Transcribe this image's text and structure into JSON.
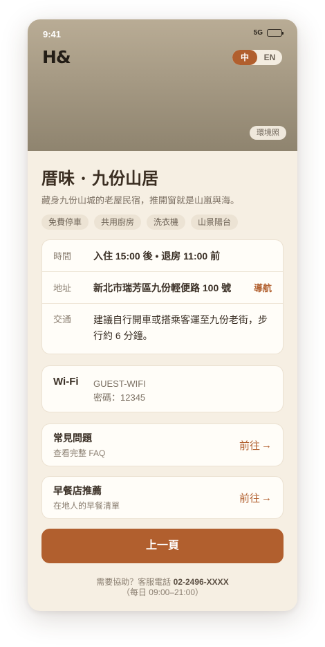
{
  "status": {
    "time": "9:41",
    "network": "5G"
  },
  "header": {
    "logo": "H&",
    "lang_zh": "中",
    "lang_en": "EN",
    "env_photo": "環境照"
  },
  "property": {
    "title": "厝味 · 九份山居",
    "subtitle": "藏身九份山城的老屋民宿，推開窗就是山嵐與海。",
    "tags": [
      "免費停車",
      "共用廚房",
      "洗衣機",
      "山景陽台"
    ]
  },
  "info": {
    "time_label": "時間",
    "time_value": "入住 15:00 後 • 退房 11:00 前",
    "address_label": "地址",
    "address_value": "新北市瑞芳區九份輕便路 100 號",
    "navigate_label": "導航",
    "transport_label": "交通",
    "transport_value": "建議自行開車或搭乘客運至九份老街，步行約 6 分鐘。"
  },
  "wifi": {
    "label": "Wi-Fi",
    "ssid": "GUEST-WIFI",
    "password": "密碼：12345"
  },
  "faq": {
    "title": "常見問題",
    "subtitle": "查看完整 FAQ",
    "go": "前往"
  },
  "breakfast": {
    "title": "早餐店推薦",
    "subtitle": "在地人的早餐清單",
    "go": "前往"
  },
  "back_button": "上一頁",
  "help": {
    "prefix": "需要協助？客服電話 ",
    "phone": "02-2496-XXXX",
    "hours": "（每日 09:00–21:00）"
  },
  "colors": {
    "accent": "#b15f2e",
    "background": "#f6efe3"
  }
}
